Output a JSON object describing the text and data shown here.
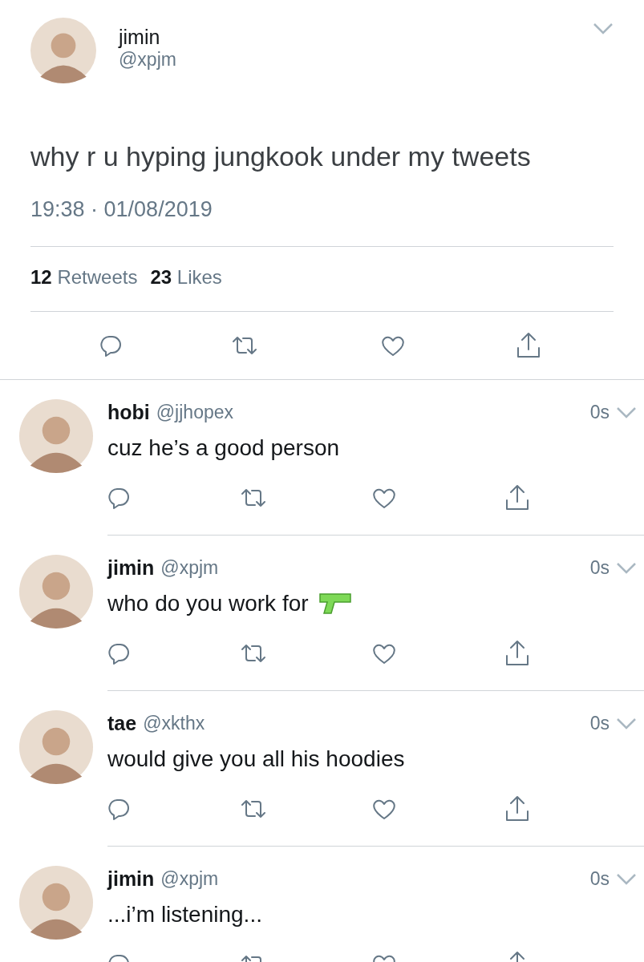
{
  "main_tweet": {
    "author": {
      "name": "jimin",
      "handle": "@xpjm"
    },
    "text": "why r u hyping jungkook under my tweets",
    "timestamp": "19:38 · 01/08/2019",
    "stats": [
      {
        "count": "12",
        "label": "Retweets"
      },
      {
        "count": "23",
        "label": "Likes"
      }
    ]
  },
  "replies": [
    {
      "name": "hobi",
      "handle": "@jjhopex",
      "time": "0s",
      "text": "cuz he’s a good person",
      "kind": "plain"
    },
    {
      "name": "jimin",
      "handle": "@xpjm",
      "time": "0s",
      "text": "who do you work for",
      "kind": "with-emoji"
    },
    {
      "name": "tae",
      "handle": "@xkthx",
      "time": "0s",
      "text": "would give you all his hoodies",
      "kind": "plain"
    },
    {
      "name": "jimin",
      "handle": "@xpjm",
      "time": "0s",
      "text": "...i’m listening...",
      "kind": "plain"
    }
  ]
}
